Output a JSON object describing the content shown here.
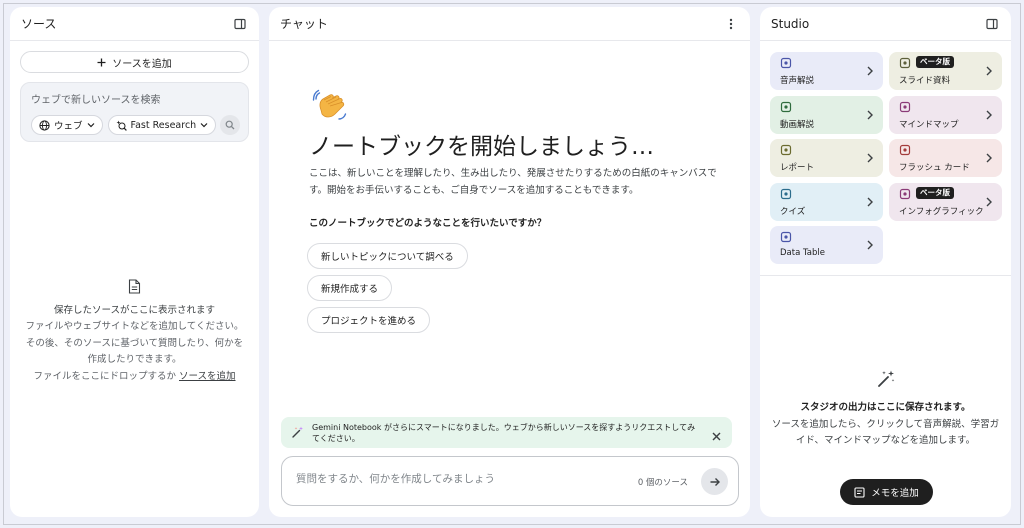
{
  "sources": {
    "title": "ソース",
    "add_button": "ソースを追加",
    "search_placeholder": "ウェブで新しいソースを検索",
    "web_chip": "ウェブ",
    "research_chip": "Fast Research",
    "empty_title": "保存したソースがここに表示されます",
    "empty_line1": "ファイルやウェブサイトなどを追加してください。",
    "empty_line2": "その後、そのソースに基づいて質問したり、何かを",
    "empty_line3": "作成したりできます。",
    "empty_line4_prefix": "ファイルをここにドロップするか ",
    "empty_link": "ソースを追加"
  },
  "chat": {
    "title": "チャット",
    "heading": "ノートブックを開始しましょう…",
    "description": "ここは、新しいことを理解したり、生み出したり、発展させたりするための白紙のキャンバスです。開始をお手伝いすることも、ご自身でソースを追加することもできます。",
    "question": "このノートブックでどのようなことを行いたいですか？",
    "suggestions": [
      "新しいトピックについて調べる",
      "新規作成する",
      "プロジェクトを進める"
    ],
    "banner": "Gemini Notebook がさらにスマートになりました。ウェブから新しいソースを探すようリクエストしてみてください。",
    "input_placeholder": "質問をするか、何かを作成してみましょう",
    "source_count": "0 個のソース"
  },
  "studio": {
    "title": "Studio",
    "tiles": [
      {
        "label": "音声解説",
        "badge": "",
        "bg": "#e9ebf8",
        "icon_color": "#4a55a8"
      },
      {
        "label": "スライド資料",
        "badge": "ベータ版",
        "bg": "#eeeee2",
        "icon_color": "#5c5f3a"
      },
      {
        "label": "動画解説",
        "badge": "",
        "bg": "#e2f0e5",
        "icon_color": "#2f6b3d"
      },
      {
        "label": "マインドマップ",
        "badge": "",
        "bg": "#f0e6ee",
        "icon_color": "#8a3a77"
      },
      {
        "label": "レポート",
        "badge": "",
        "bg": "#eeeee2",
        "icon_color": "#6b6b2f"
      },
      {
        "label": "フラッシュ カード",
        "badge": "",
        "bg": "#f6e7e7",
        "icon_color": "#a33b3b"
      },
      {
        "label": "クイズ",
        "badge": "",
        "bg": "#e1eff6",
        "icon_color": "#2b6c8c"
      },
      {
        "label": "インフォグラフィック",
        "badge": "ベータ版",
        "bg": "#f0e6ee",
        "icon_color": "#8a3a77"
      },
      {
        "label": "Data Table",
        "badge": "",
        "bg": "#e9ebf8",
        "icon_color": "#4a55a8"
      }
    ],
    "empty_title": "スタジオの出力はここに保存されます。",
    "empty_text1": "ソースを追加したら、クリックして音声解説、学習ガ",
    "empty_text2": "イド、マインドマップなどを追加します。",
    "note_button": "メモを追加"
  }
}
